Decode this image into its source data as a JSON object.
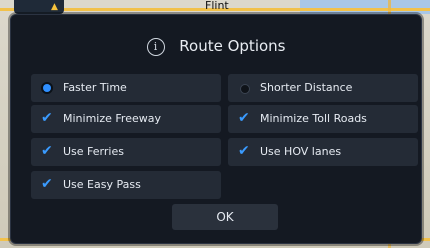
{
  "map": {
    "city_label": "Flint"
  },
  "dialog": {
    "icon": "info-icon",
    "title": "Route Options",
    "options": {
      "faster_time": {
        "label": "Faster Time",
        "selected": true
      },
      "shorter_distance": {
        "label": "Shorter Distance",
        "selected": false
      },
      "minimize_freeway": {
        "label": "Minimize Freeway",
        "checked": true
      },
      "minimize_toll_roads": {
        "label": "Minimize Toll Roads",
        "checked": true
      },
      "use_ferries": {
        "label": "Use Ferries",
        "checked": true
      },
      "use_hov_lanes": {
        "label": "Use HOV lanes",
        "checked": true
      },
      "use_easy_pass": {
        "label": "Use Easy Pass",
        "checked": true
      }
    },
    "ok_label": "OK"
  },
  "colors": {
    "accent": "#2f8fff",
    "panel": "#141922",
    "option_bg": "#242b36"
  }
}
